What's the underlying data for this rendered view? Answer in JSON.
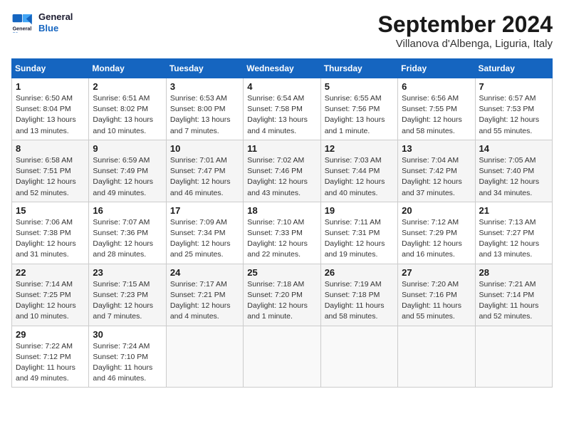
{
  "logo": {
    "line1": "General",
    "line2": "Blue"
  },
  "title": "September 2024",
  "subtitle": "Villanova d'Albenga, Liguria, Italy",
  "days_of_week": [
    "Sunday",
    "Monday",
    "Tuesday",
    "Wednesday",
    "Thursday",
    "Friday",
    "Saturday"
  ],
  "weeks": [
    [
      {
        "num": "1",
        "detail": "Sunrise: 6:50 AM\nSunset: 8:04 PM\nDaylight: 13 hours\nand 13 minutes."
      },
      {
        "num": "2",
        "detail": "Sunrise: 6:51 AM\nSunset: 8:02 PM\nDaylight: 13 hours\nand 10 minutes."
      },
      {
        "num": "3",
        "detail": "Sunrise: 6:53 AM\nSunset: 8:00 PM\nDaylight: 13 hours\nand 7 minutes."
      },
      {
        "num": "4",
        "detail": "Sunrise: 6:54 AM\nSunset: 7:58 PM\nDaylight: 13 hours\nand 4 minutes."
      },
      {
        "num": "5",
        "detail": "Sunrise: 6:55 AM\nSunset: 7:56 PM\nDaylight: 13 hours\nand 1 minute."
      },
      {
        "num": "6",
        "detail": "Sunrise: 6:56 AM\nSunset: 7:55 PM\nDaylight: 12 hours\nand 58 minutes."
      },
      {
        "num": "7",
        "detail": "Sunrise: 6:57 AM\nSunset: 7:53 PM\nDaylight: 12 hours\nand 55 minutes."
      }
    ],
    [
      {
        "num": "8",
        "detail": "Sunrise: 6:58 AM\nSunset: 7:51 PM\nDaylight: 12 hours\nand 52 minutes."
      },
      {
        "num": "9",
        "detail": "Sunrise: 6:59 AM\nSunset: 7:49 PM\nDaylight: 12 hours\nand 49 minutes."
      },
      {
        "num": "10",
        "detail": "Sunrise: 7:01 AM\nSunset: 7:47 PM\nDaylight: 12 hours\nand 46 minutes."
      },
      {
        "num": "11",
        "detail": "Sunrise: 7:02 AM\nSunset: 7:46 PM\nDaylight: 12 hours\nand 43 minutes."
      },
      {
        "num": "12",
        "detail": "Sunrise: 7:03 AM\nSunset: 7:44 PM\nDaylight: 12 hours\nand 40 minutes."
      },
      {
        "num": "13",
        "detail": "Sunrise: 7:04 AM\nSunset: 7:42 PM\nDaylight: 12 hours\nand 37 minutes."
      },
      {
        "num": "14",
        "detail": "Sunrise: 7:05 AM\nSunset: 7:40 PM\nDaylight: 12 hours\nand 34 minutes."
      }
    ],
    [
      {
        "num": "15",
        "detail": "Sunrise: 7:06 AM\nSunset: 7:38 PM\nDaylight: 12 hours\nand 31 minutes."
      },
      {
        "num": "16",
        "detail": "Sunrise: 7:07 AM\nSunset: 7:36 PM\nDaylight: 12 hours\nand 28 minutes."
      },
      {
        "num": "17",
        "detail": "Sunrise: 7:09 AM\nSunset: 7:34 PM\nDaylight: 12 hours\nand 25 minutes."
      },
      {
        "num": "18",
        "detail": "Sunrise: 7:10 AM\nSunset: 7:33 PM\nDaylight: 12 hours\nand 22 minutes."
      },
      {
        "num": "19",
        "detail": "Sunrise: 7:11 AM\nSunset: 7:31 PM\nDaylight: 12 hours\nand 19 minutes."
      },
      {
        "num": "20",
        "detail": "Sunrise: 7:12 AM\nSunset: 7:29 PM\nDaylight: 12 hours\nand 16 minutes."
      },
      {
        "num": "21",
        "detail": "Sunrise: 7:13 AM\nSunset: 7:27 PM\nDaylight: 12 hours\nand 13 minutes."
      }
    ],
    [
      {
        "num": "22",
        "detail": "Sunrise: 7:14 AM\nSunset: 7:25 PM\nDaylight: 12 hours\nand 10 minutes."
      },
      {
        "num": "23",
        "detail": "Sunrise: 7:15 AM\nSunset: 7:23 PM\nDaylight: 12 hours\nand 7 minutes."
      },
      {
        "num": "24",
        "detail": "Sunrise: 7:17 AM\nSunset: 7:21 PM\nDaylight: 12 hours\nand 4 minutes."
      },
      {
        "num": "25",
        "detail": "Sunrise: 7:18 AM\nSunset: 7:20 PM\nDaylight: 12 hours\nand 1 minute."
      },
      {
        "num": "26",
        "detail": "Sunrise: 7:19 AM\nSunset: 7:18 PM\nDaylight: 11 hours\nand 58 minutes."
      },
      {
        "num": "27",
        "detail": "Sunrise: 7:20 AM\nSunset: 7:16 PM\nDaylight: 11 hours\nand 55 minutes."
      },
      {
        "num": "28",
        "detail": "Sunrise: 7:21 AM\nSunset: 7:14 PM\nDaylight: 11 hours\nand 52 minutes."
      }
    ],
    [
      {
        "num": "29",
        "detail": "Sunrise: 7:22 AM\nSunset: 7:12 PM\nDaylight: 11 hours\nand 49 minutes."
      },
      {
        "num": "30",
        "detail": "Sunrise: 7:24 AM\nSunset: 7:10 PM\nDaylight: 11 hours\nand 46 minutes."
      },
      {
        "num": "",
        "detail": ""
      },
      {
        "num": "",
        "detail": ""
      },
      {
        "num": "",
        "detail": ""
      },
      {
        "num": "",
        "detail": ""
      },
      {
        "num": "",
        "detail": ""
      }
    ]
  ]
}
